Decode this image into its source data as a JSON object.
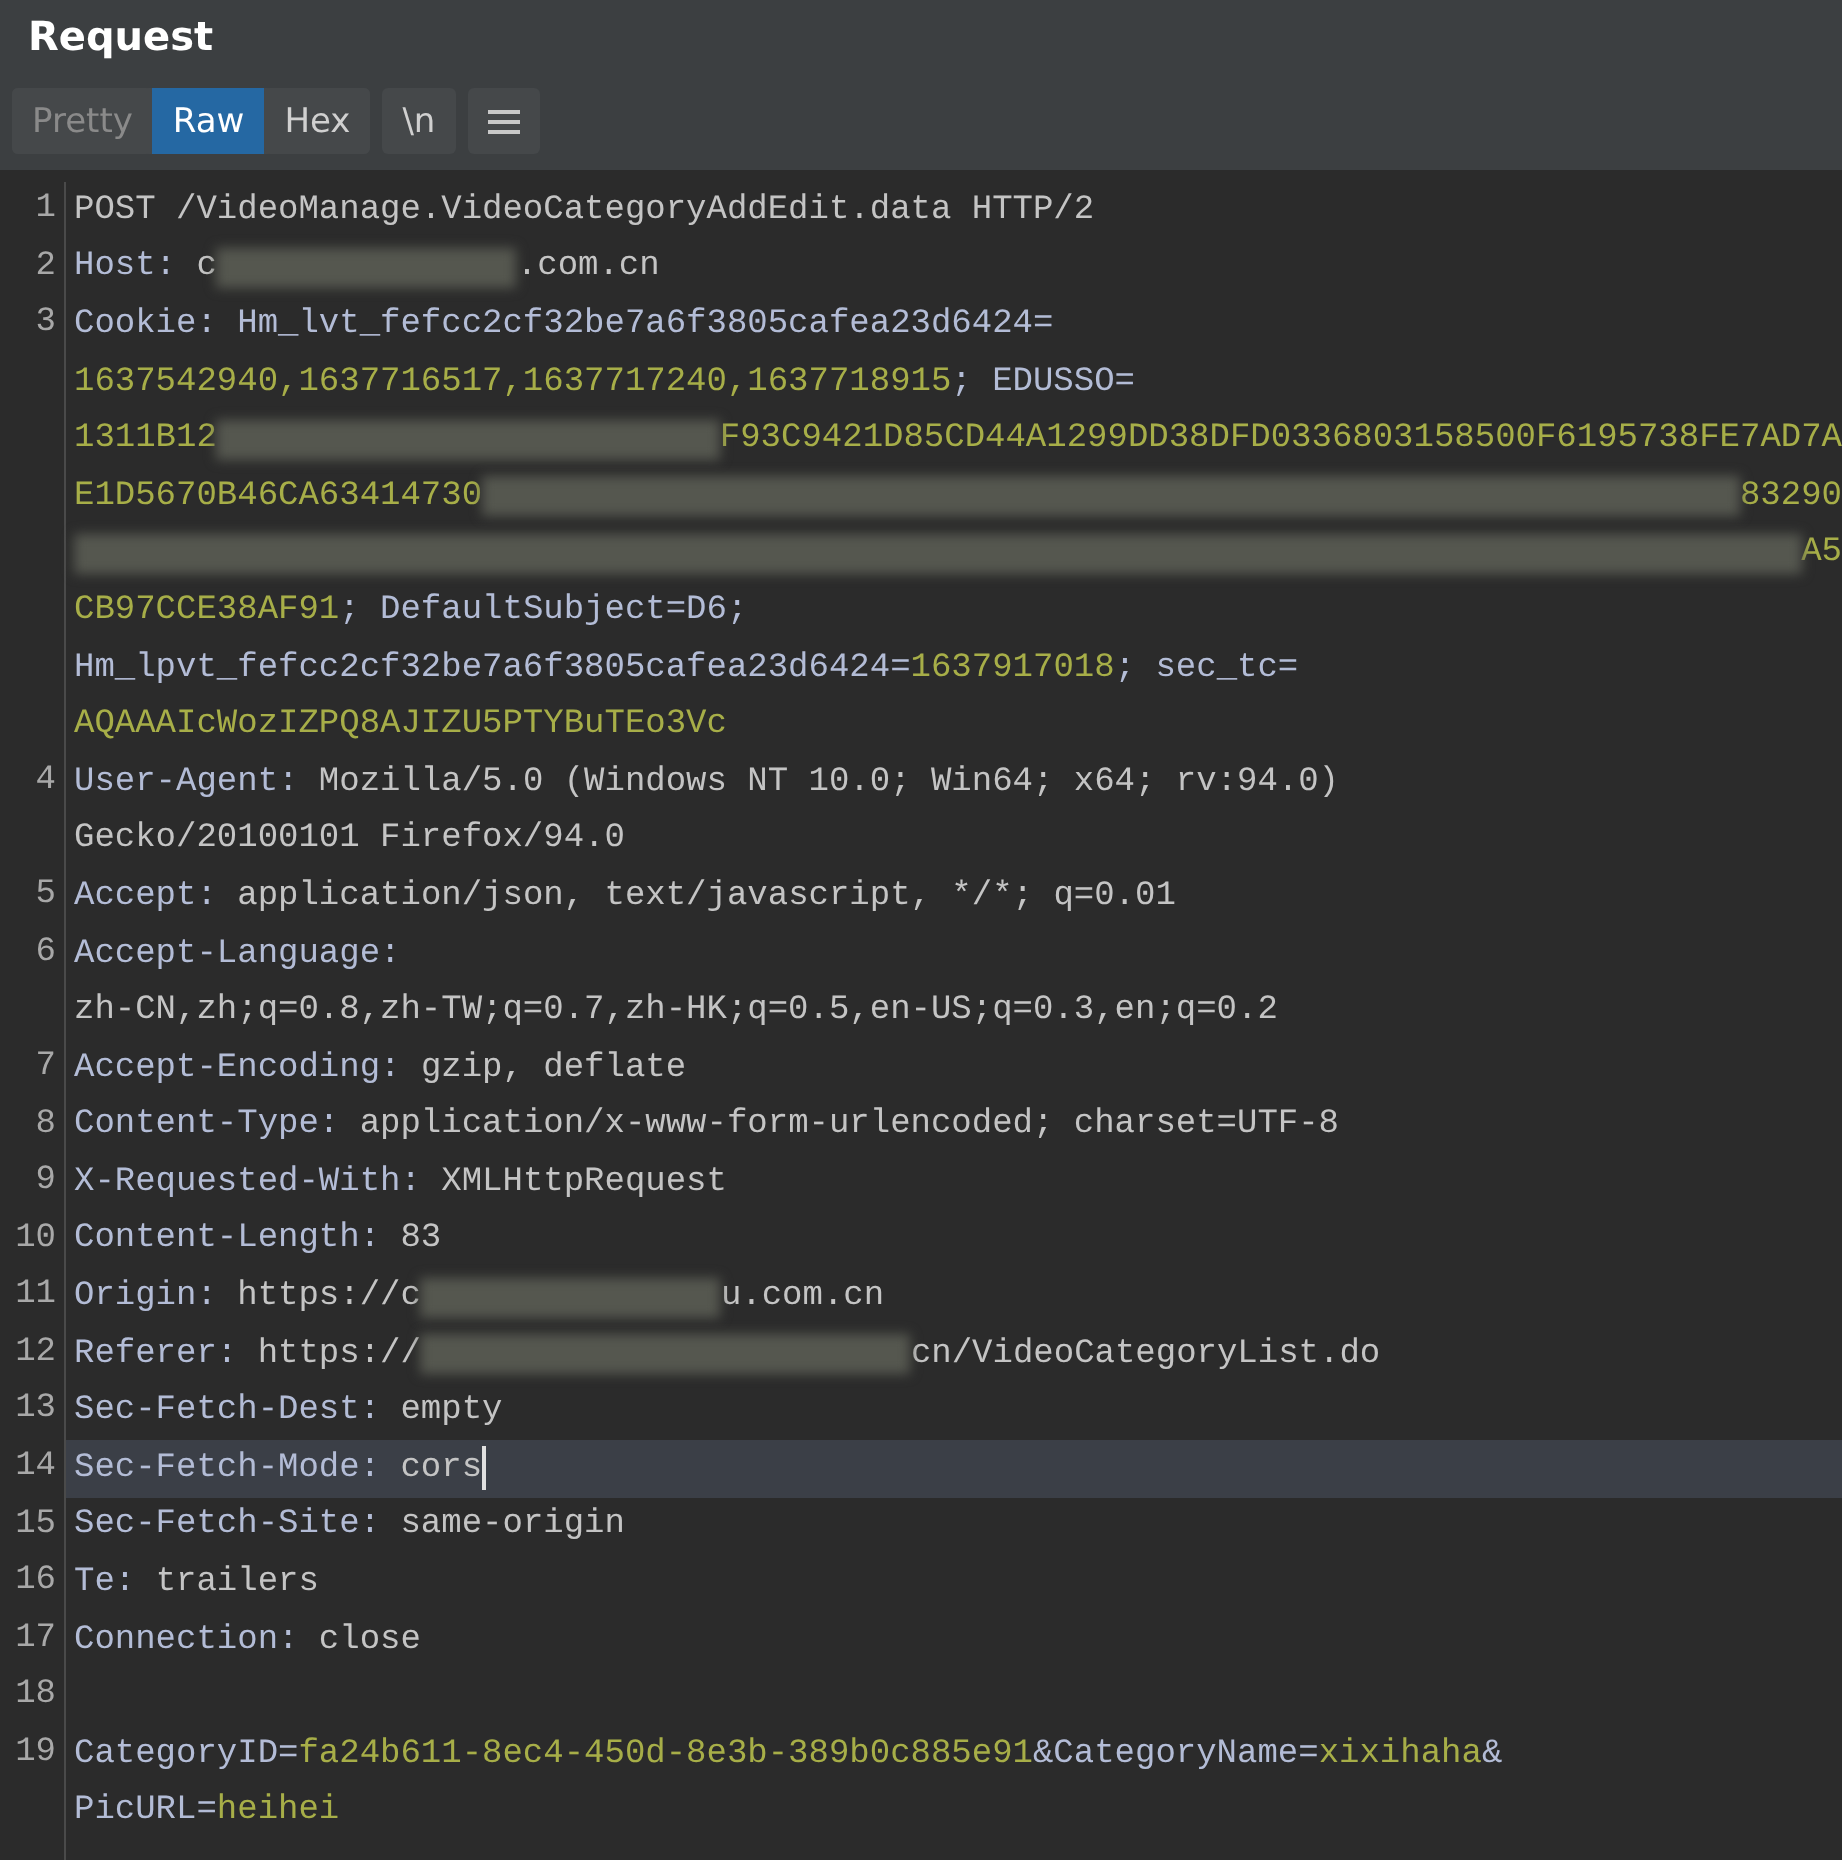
{
  "panel": {
    "title": "Request"
  },
  "view_tabs": [
    {
      "label": "Pretty",
      "selected": false,
      "disabled": true
    },
    {
      "label": "Raw",
      "selected": true,
      "disabled": false
    },
    {
      "label": "Hex",
      "selected": false,
      "disabled": false
    }
  ],
  "toolbar_buttons": [
    {
      "kind": "text",
      "label": "\\n"
    },
    {
      "kind": "menu"
    }
  ],
  "lines": [
    {
      "number": "1",
      "current": false,
      "rows": [
        {
          "segments": [
            {
              "kind": "plain",
              "text": "POST /VideoManage.VideoCategoryAddEdit.data HTTP/2"
            }
          ]
        }
      ]
    },
    {
      "number": "2",
      "current": false,
      "rows": [
        {
          "segments": [
            {
              "kind": "key",
              "text": "Host: "
            },
            {
              "kind": "plain",
              "text": "c"
            },
            {
              "kind": "redacted"
            },
            {
              "kind": "plain",
              "text": ".com.cn"
            }
          ]
        }
      ]
    },
    {
      "number": "3",
      "current": false,
      "rows": [
        {
          "segments": [
            {
              "kind": "key",
              "text": "Cookie: Hm_lvt_fefcc2cf32be7a6f3805cafea23d6424="
            }
          ]
        },
        {
          "segments": [
            {
              "kind": "value",
              "text": "1637542940,1637716517,1637717240,1637718915"
            },
            {
              "kind": "key",
              "text": "; EDUSSO="
            }
          ]
        },
        {
          "segments": [
            {
              "kind": "value",
              "text": "1311B12"
            },
            {
              "kind": "redacted-fill"
            },
            {
              "kind": "value",
              "text": "F93C9421D85CD44A1299DD38DFD0336803158500F6195738FE7AD7A"
            }
          ]
        },
        {
          "segments": [
            {
              "kind": "value",
              "text": "E1D5670B46CA63414730"
            },
            {
              "kind": "redacted-fill"
            },
            {
              "kind": "value",
              "text": "83290"
            }
          ]
        },
        {
          "segments": [
            {
              "kind": "redacted-fill"
            },
            {
              "kind": "value",
              "text": "A5"
            }
          ]
        },
        {
          "segments": [
            {
              "kind": "value",
              "text": "CB97CCE38AF91"
            },
            {
              "kind": "key",
              "text": "; DefaultSubject=D6;"
            }
          ]
        },
        {
          "segments": [
            {
              "kind": "key",
              "text": "Hm_lpvt_fefcc2cf32be7a6f3805cafea23d6424="
            },
            {
              "kind": "value",
              "text": "1637917018"
            },
            {
              "kind": "key",
              "text": "; sec_tc="
            }
          ]
        },
        {
          "segments": [
            {
              "kind": "value",
              "text": "AQAAAIcWozIZPQ8AJIZU5PTYBuTEo3Vc"
            }
          ]
        }
      ]
    },
    {
      "number": "4",
      "current": false,
      "rows": [
        {
          "segments": [
            {
              "kind": "key",
              "text": "User-Agent: "
            },
            {
              "kind": "plain",
              "text": "Mozilla/5.0 (Windows NT 10.0; Win64; x64; rv:94.0)"
            }
          ]
        },
        {
          "segments": [
            {
              "kind": "plain",
              "text": "Gecko/20100101 Firefox/94.0"
            }
          ]
        }
      ]
    },
    {
      "number": "5",
      "current": false,
      "rows": [
        {
          "segments": [
            {
              "kind": "key",
              "text": "Accept: "
            },
            {
              "kind": "plain",
              "text": "application/json, text/javascript, */*; q=0.01"
            }
          ]
        }
      ]
    },
    {
      "number": "6",
      "current": false,
      "rows": [
        {
          "segments": [
            {
              "kind": "key",
              "text": "Accept-Language:"
            }
          ]
        },
        {
          "segments": [
            {
              "kind": "plain",
              "text": "zh-CN,zh;q=0.8,zh-TW;q=0.7,zh-HK;q=0.5,en-US;q=0.3,en;q=0.2"
            }
          ]
        }
      ]
    },
    {
      "number": "7",
      "current": false,
      "rows": [
        {
          "segments": [
            {
              "kind": "key",
              "text": "Accept-Encoding: "
            },
            {
              "kind": "plain",
              "text": "gzip, deflate"
            }
          ]
        }
      ]
    },
    {
      "number": "8",
      "current": false,
      "rows": [
        {
          "segments": [
            {
              "kind": "key",
              "text": "Content-Type: "
            },
            {
              "kind": "plain",
              "text": "application/x-www-form-urlencoded; charset=UTF-8"
            }
          ]
        }
      ]
    },
    {
      "number": "9",
      "current": false,
      "rows": [
        {
          "segments": [
            {
              "kind": "key",
              "text": "X-Requested-With: "
            },
            {
              "kind": "plain",
              "text": "XMLHttpRequest"
            }
          ]
        }
      ]
    },
    {
      "number": "10",
      "current": false,
      "rows": [
        {
          "segments": [
            {
              "kind": "key",
              "text": "Content-Length: "
            },
            {
              "kind": "plain",
              "text": "83"
            }
          ]
        }
      ]
    },
    {
      "number": "11",
      "current": false,
      "rows": [
        {
          "segments": [
            {
              "kind": "key",
              "text": "Origin: "
            },
            {
              "kind": "plain",
              "text": "https://c"
            },
            {
              "kind": "redacted"
            },
            {
              "kind": "plain",
              "text": "u.com.cn"
            }
          ]
        }
      ]
    },
    {
      "number": "12",
      "current": false,
      "rows": [
        {
          "segments": [
            {
              "kind": "key",
              "text": "Referer: "
            },
            {
              "kind": "plain",
              "text": "https://"
            },
            {
              "kind": "redacted-wide"
            },
            {
              "kind": "plain",
              "text": "cn/VideoCategoryList.do"
            }
          ]
        }
      ]
    },
    {
      "number": "13",
      "current": false,
      "rows": [
        {
          "segments": [
            {
              "kind": "key",
              "text": "Sec-Fetch-Dest: "
            },
            {
              "kind": "plain",
              "text": "empty"
            }
          ]
        }
      ]
    },
    {
      "number": "14",
      "current": true,
      "rows": [
        {
          "segments": [
            {
              "kind": "key",
              "text": "Sec-Fetch-Mode: "
            },
            {
              "kind": "plain",
              "text": "cors"
            }
          ]
        }
      ]
    },
    {
      "number": "15",
      "current": false,
      "rows": [
        {
          "segments": [
            {
              "kind": "key",
              "text": "Sec-Fetch-Site: "
            },
            {
              "kind": "plain",
              "text": "same-origin"
            }
          ]
        }
      ]
    },
    {
      "number": "16",
      "current": false,
      "rows": [
        {
          "segments": [
            {
              "kind": "key",
              "text": "Te: "
            },
            {
              "kind": "plain",
              "text": "trailers"
            }
          ]
        }
      ]
    },
    {
      "number": "17",
      "current": false,
      "rows": [
        {
          "segments": [
            {
              "kind": "key",
              "text": "Connection: "
            },
            {
              "kind": "plain",
              "text": "close"
            }
          ]
        }
      ]
    },
    {
      "number": "18",
      "current": false
    },
    {
      "number": "19",
      "current": false,
      "rows": [
        {
          "segments": [
            {
              "kind": "key",
              "text": "CategoryID="
            },
            {
              "kind": "value",
              "text": "fa24b611-8ec4-450d-8e3b-389b0c885e91"
            },
            {
              "kind": "key",
              "text": "&CategoryName="
            },
            {
              "kind": "value",
              "text": "xixihaha"
            },
            {
              "kind": "key",
              "text": "&"
            }
          ]
        },
        {
          "segments": [
            {
              "kind": "key",
              "text": "PicURL="
            },
            {
              "kind": "value",
              "text": "heihei"
            }
          ]
        }
      ]
    }
  ]
}
